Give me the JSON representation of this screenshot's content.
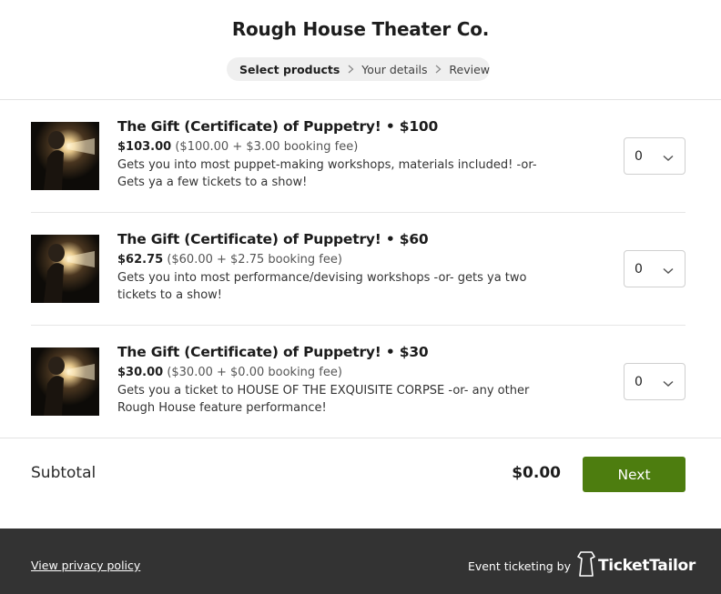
{
  "header": {
    "title": "Rough House Theater Co.",
    "steps": [
      {
        "label": "Select products",
        "active": true
      },
      {
        "label": "Your details",
        "active": false
      },
      {
        "label": "Review",
        "active": false
      }
    ]
  },
  "products": [
    {
      "name": "The Gift (Certificate) of Puppetry! • $100",
      "total": "$103.00",
      "breakdown": "($100.00 + $3.00 booking fee)",
      "description": "Gets you into most puppet-making workshops, materials included! -or- Gets ya a few tickets to a show!",
      "quantity": "0"
    },
    {
      "name": "The Gift (Certificate) of Puppetry! • $60",
      "total": "$62.75",
      "breakdown": "($60.00 + $2.75 booking fee)",
      "description": "Gets you into most performance/devising workshops -or- gets ya two tickets to a show!",
      "quantity": "0"
    },
    {
      "name": "The Gift (Certificate) of Puppetry! • $30",
      "total": "$30.00",
      "breakdown": "($30.00 + $0.00 booking fee)",
      "description": "Gets you a ticket to HOUSE OF THE EXQUISITE CORPSE -or- any other Rough House feature performance!",
      "quantity": "0"
    }
  ],
  "summary": {
    "label": "Subtotal",
    "amount": "$0.00",
    "next_label": "Next"
  },
  "footer": {
    "privacy_label": "View privacy policy",
    "ticketing_label": "Event ticketing by",
    "brand_name": "TicketTailor"
  },
  "colors": {
    "accent": "#4d7d0f",
    "footer_bg": "#333333",
    "stepper_bg": "#efefef"
  },
  "icons": {
    "step_separator": "chevron-right-icon",
    "select_arrow": "chevron-down-icon",
    "brand_logo": "ticket-tailor-logo"
  }
}
